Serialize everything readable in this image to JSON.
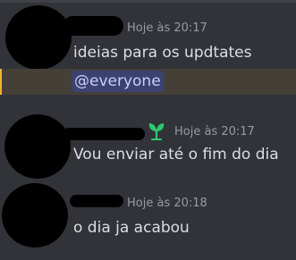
{
  "messages": [
    {
      "timestamp": "Hoje às 20:17",
      "lines": [
        "ideias para os updtates"
      ],
      "mention": "@everyone"
    },
    {
      "timestamp": "Hoje às 20:17",
      "lines": [
        "Vou enviar até o fim do dia"
      ],
      "badge_icon": "green-leaf-icon",
      "badge_color": "#2dc770"
    },
    {
      "timestamp": "Hoje às 20:18",
      "lines": [
        "o dia ja acabou"
      ]
    }
  ],
  "colors": {
    "background": "#313338",
    "text": "#dbdee1",
    "timestamp": "#949ba4",
    "mention_highlight_bg": "#444037",
    "mention_bar": "#f0b232",
    "mention_pill_bg": "#3c4270",
    "mention_pill_text": "#c9cdfb"
  }
}
